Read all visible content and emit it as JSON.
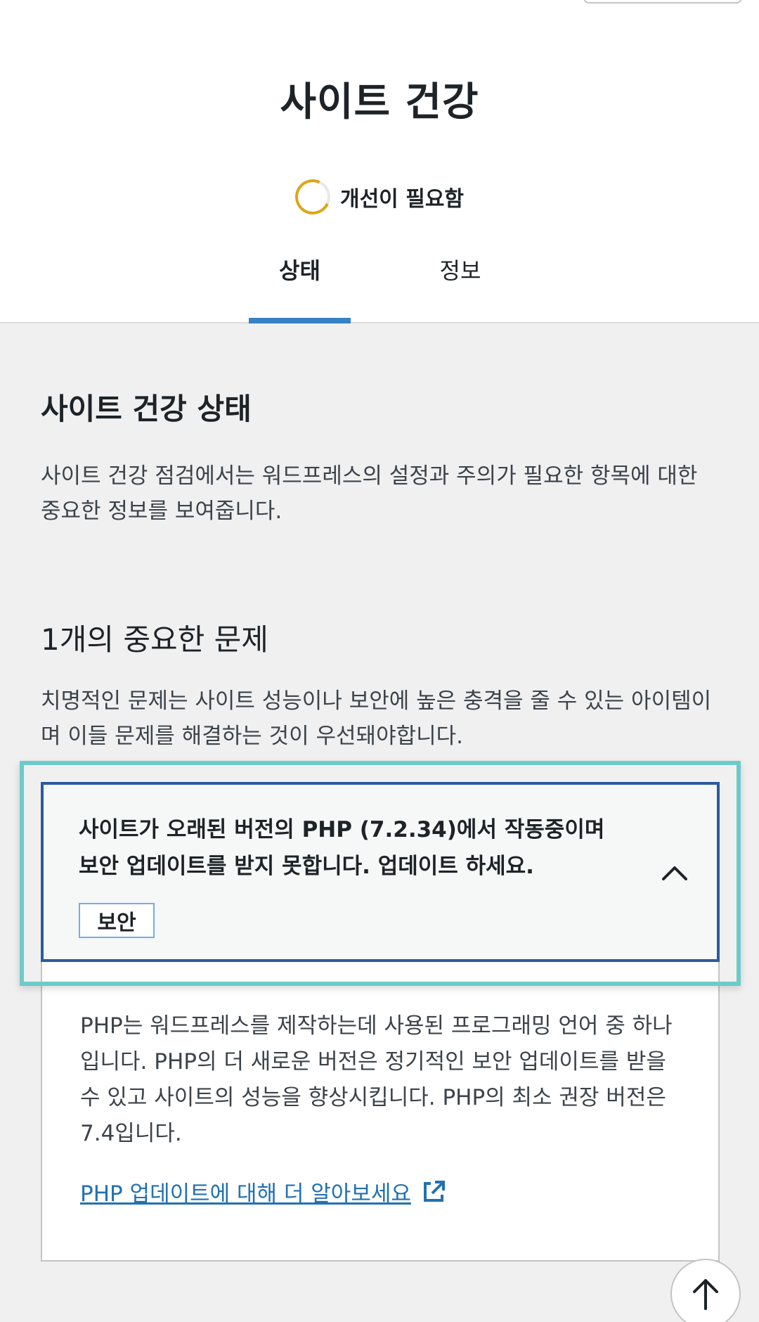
{
  "header": {
    "title": "사이트 건강",
    "status_label": "개선이 필요함",
    "status_color": "#dba617"
  },
  "tabs": [
    {
      "label": "상태",
      "active": true
    },
    {
      "label": "정보",
      "active": false
    }
  ],
  "section": {
    "title": "사이트 건강 상태",
    "description": "사이트 건강 점검에서는 워드프레스의 설정과 주의가 필요한 항목에 대한 중요한 정보를 보여줍니다."
  },
  "issues": {
    "title": "1개의 중요한 문제",
    "description": "치명적인 문제는 사이트 성능이나 보안에 높은 충격을 줄 수 있는 아이템이며 이들 문제를 해결하는 것이 우선돼야합니다.",
    "items": [
      {
        "title": "사이트가 오래된 버전의 PHP (7.2.34)에서 작동중이며 보안 업데이트를 받지 못합니다. 업데이트 하세요.",
        "badge": "보안",
        "body": "PHP는 워드프레스를 제작하는데 사용된 프로그래밍 언어 중 하나입니다. PHP의 더 새로운 버전은 정기적인 보안 업데이트를 받을 수 있고 사이트의 성능을 향상시킵니다. PHP의 최소 권장 버전은 7.4입니다.",
        "link_label": "PHP 업데이트에 대해 더 알아보세요",
        "expanded": true
      }
    ]
  },
  "colors": {
    "accent": "#3582c4",
    "link": "#2271b1",
    "highlight": "#6ccbc9",
    "focus_border": "#2c5aa0"
  }
}
